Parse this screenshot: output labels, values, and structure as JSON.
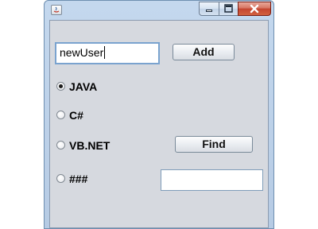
{
  "username_field": {
    "value": "newUser"
  },
  "buttons": {
    "add": "Add",
    "find": "Find"
  },
  "languages": [
    {
      "label": "JAVA",
      "selected": true
    },
    {
      "label": "C#",
      "selected": false
    },
    {
      "label": "VB.NET",
      "selected": false
    },
    {
      "label": "###",
      "selected": false
    }
  ],
  "extra_field": {
    "value": ""
  },
  "icons": {
    "app": "java-app-icon",
    "minimize": "minimize-icon",
    "maximize": "maximize-icon",
    "close": "close-icon"
  },
  "colors": {
    "client_background": "#d6d9df",
    "titlebar": "#c4d8ee",
    "close_button": "#c44530"
  }
}
